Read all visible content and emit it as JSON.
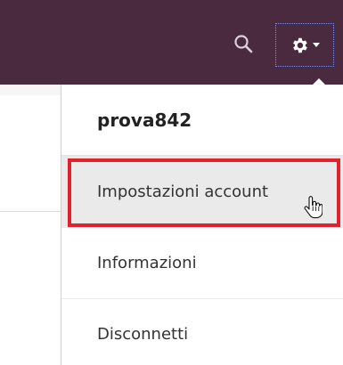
{
  "colors": {
    "topbar": "#4a2a3f",
    "highlight": "#e0212e",
    "hover_bg": "#eaeaea"
  },
  "topbar": {
    "search_icon": "search-icon",
    "settings_icon": "gear-icon",
    "settings_dropdown_icon": "caret-down-icon"
  },
  "menu": {
    "username": "prova842",
    "items": [
      {
        "label": "Impostazioni account",
        "hovered": true
      },
      {
        "label": "Informazioni"
      },
      {
        "label": "Disconnetti"
      }
    ]
  }
}
